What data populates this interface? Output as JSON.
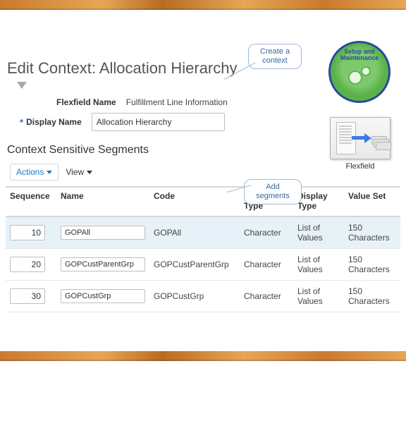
{
  "header": {
    "page_title": "Edit Context: Allocation Hierarchy",
    "flexfield_name_label": "Flexfield Name",
    "flexfield_name_value": "Fulfillment Line Information",
    "display_name_label": "Display Name",
    "display_name_value": "Allocation Hierarchy"
  },
  "segments": {
    "section_title": "Context Sensitive Segments",
    "toolbar": {
      "actions_label": "Actions",
      "view_label": "View"
    },
    "columns": {
      "sequence": "Sequence",
      "name": "Name",
      "code": "Code",
      "value_data_type": "Value Data Type",
      "display_type": "Display Type",
      "value_set": "Value Set"
    },
    "rows": [
      {
        "sequence": "10",
        "name": "GOPAll",
        "code": "GOPAll",
        "value_data_type": "Character",
        "display_type": "List of Values",
        "value_set": "150 Characters"
      },
      {
        "sequence": "20",
        "name": "GOPCustParentGrp",
        "code": "GOPCustParentGrp",
        "value_data_type": "Character",
        "display_type": "List of Values",
        "value_set": "150 Characters"
      },
      {
        "sequence": "30",
        "name": "GOPCustGrp",
        "code": "GOPCustGrp",
        "value_data_type": "Character",
        "display_type": "List of Values",
        "value_set": "150 Characters"
      }
    ]
  },
  "callouts": {
    "create_context": "Create a context",
    "add_segments": "Add segments"
  },
  "badges": {
    "setup_line1": "Setup and",
    "setup_line2": "Maintenance",
    "flexfield_caption": "Flexfield"
  }
}
